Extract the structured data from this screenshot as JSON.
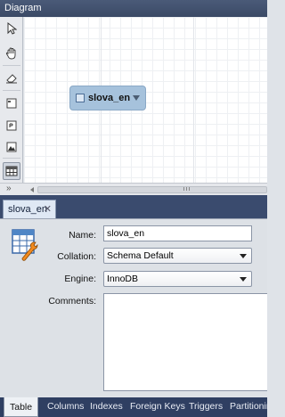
{
  "diagram": {
    "title": "Diagram",
    "table_node": {
      "label": "slova_en"
    },
    "expand_label": "»"
  },
  "toolbar": {
    "tools": [
      {
        "name": "pointer",
        "icon": "arrow-pointer-icon"
      },
      {
        "name": "hand",
        "icon": "hand-icon"
      },
      {
        "name": "eraser",
        "icon": "eraser-icon"
      },
      {
        "name": "layer",
        "icon": "layer-icon"
      },
      {
        "name": "note",
        "icon": "note-icon"
      },
      {
        "name": "image",
        "icon": "image-icon"
      },
      {
        "name": "table",
        "icon": "table-icon"
      }
    ]
  },
  "editor": {
    "tab_label": "slova_en",
    "close_label": "✕",
    "fields": {
      "name_label": "Name:",
      "name_value": "slova_en",
      "collation_label": "Collation:",
      "collation_value": "Schema Default",
      "engine_label": "Engine:",
      "engine_value": "InnoDB",
      "comments_label": "Comments:"
    },
    "bottom_tabs": [
      "Table",
      "Columns",
      "Indexes",
      "Foreign Keys",
      "Triggers",
      "Partitioning"
    ]
  },
  "colors": {
    "header_bg": "#3b4a66",
    "node_fill": "#a6c2dc",
    "panel_bg": "#dde1e6"
  }
}
